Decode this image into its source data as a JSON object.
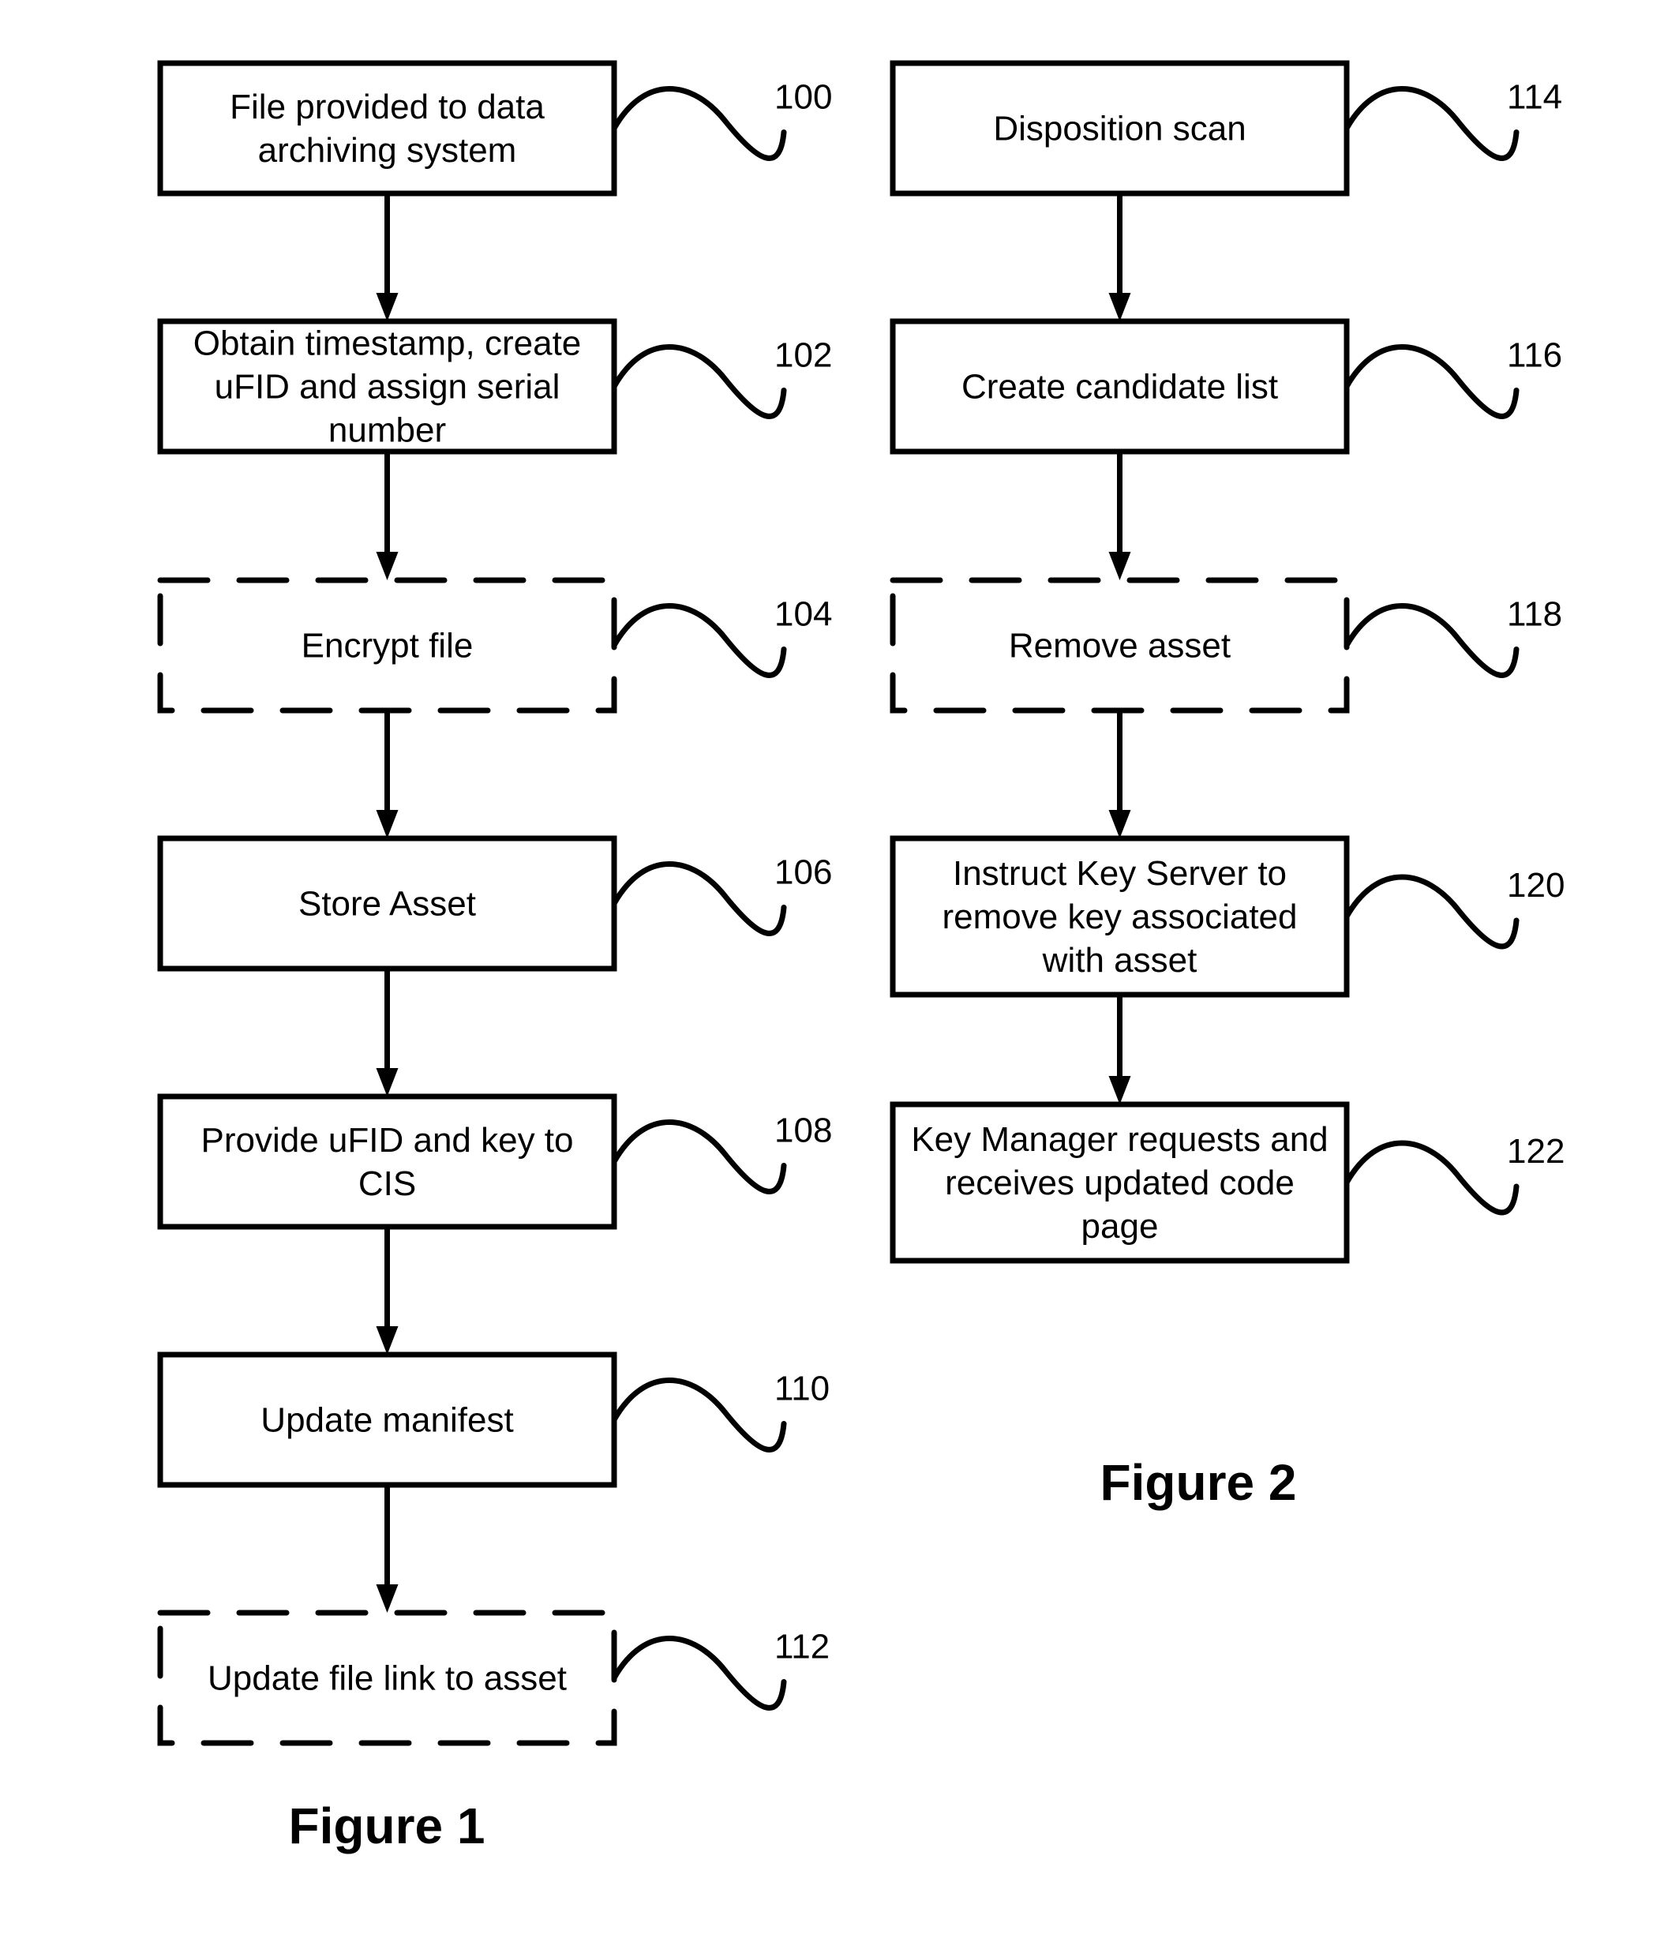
{
  "figures": [
    {
      "caption": "Figure 1",
      "steps": [
        {
          "ref": "100",
          "lines": [
            "File provided to data",
            "archiving system"
          ],
          "optional": false
        },
        {
          "ref": "102",
          "lines": [
            "Obtain timestamp, create",
            "uFID and assign serial",
            "number"
          ],
          "optional": false
        },
        {
          "ref": "104",
          "lines": [
            "Encrypt file"
          ],
          "optional": true
        },
        {
          "ref": "106",
          "lines": [
            "Store Asset"
          ],
          "optional": false
        },
        {
          "ref": "108",
          "lines": [
            "Provide uFID and key to",
            "CIS"
          ],
          "optional": false
        },
        {
          "ref": "110",
          "lines": [
            "Update manifest"
          ],
          "optional": false
        },
        {
          "ref": "112",
          "lines": [
            "Update file link to asset"
          ],
          "optional": true
        }
      ]
    },
    {
      "caption": "Figure 2",
      "steps": [
        {
          "ref": "114",
          "lines": [
            "Disposition scan"
          ],
          "optional": false
        },
        {
          "ref": "116",
          "lines": [
            "Create candidate list"
          ],
          "optional": false
        },
        {
          "ref": "118",
          "lines": [
            "Remove asset"
          ],
          "optional": true
        },
        {
          "ref": "120",
          "lines": [
            "Instruct Key Server to",
            "remove key associated",
            "with asset"
          ],
          "optional": false
        },
        {
          "ref": "122",
          "lines": [
            "Key Manager requests and",
            "receives updated code",
            "page"
          ],
          "optional": false
        }
      ]
    }
  ]
}
